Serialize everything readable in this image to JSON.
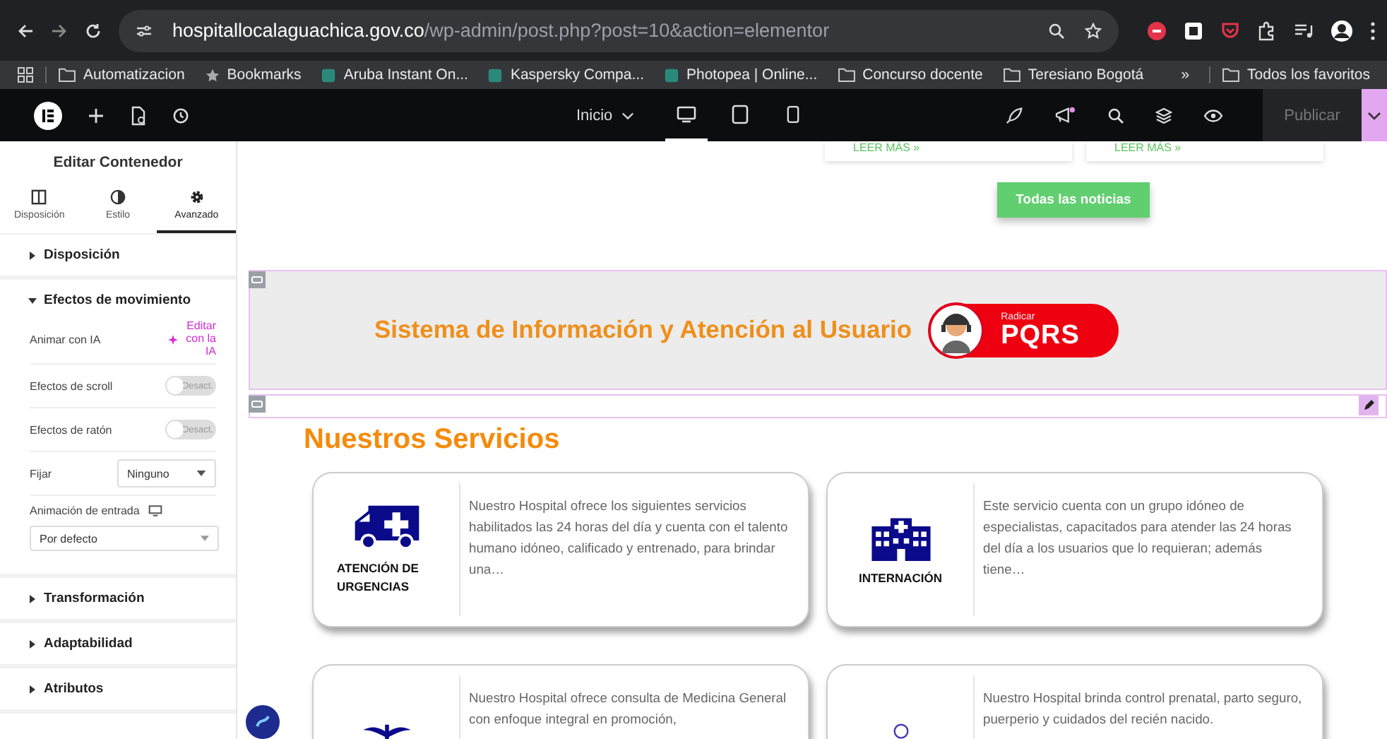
{
  "browser": {
    "host": "hospitallocalaguachica.gov.co",
    "path": "/wp-admin/post.php?post=10&action=elementor",
    "bookmarks": [
      {
        "kind": "folder",
        "label": "Automatizacion"
      },
      {
        "kind": "star",
        "label": "Bookmarks"
      },
      {
        "kind": "site",
        "label": "Aruba Instant On..."
      },
      {
        "kind": "site",
        "label": "Kaspersky Compa..."
      },
      {
        "kind": "site",
        "label": "Photopea | Online..."
      },
      {
        "kind": "folder",
        "label": "Concurso docente"
      },
      {
        "kind": "folder",
        "label": "Teresiano Bogotá"
      }
    ],
    "more": "»",
    "all_bookmarks": "Todos los favoritos"
  },
  "editor_bar": {
    "page_menu": "Inicio",
    "devices": [
      {
        "kind": "desktop",
        "selected": true
      },
      {
        "kind": "tablet",
        "selected": false
      },
      {
        "kind": "mobile",
        "selected": false
      }
    ],
    "publish": "Publicar"
  },
  "panel": {
    "title": "Editar Contenedor",
    "tabs": [
      {
        "kind": "layout",
        "label": "Disposición",
        "selected": false
      },
      {
        "kind": "style",
        "label": "Estilo",
        "selected": false
      },
      {
        "kind": "advanced",
        "label": "Avanzado",
        "selected": true
      }
    ],
    "sections": [
      {
        "title": "Disposición",
        "expanded": false
      },
      {
        "title": "Efectos de movimiento",
        "expanded": true,
        "controls": [
          {
            "kind": "ai",
            "label": "Animar con IA",
            "link": "Editar con la IA"
          },
          {
            "kind": "switch",
            "label": "Efectos de scroll",
            "on": false,
            "state_label": "Desact."
          },
          {
            "kind": "switch",
            "label": "Efectos de ratón",
            "on": false,
            "state_label": "Desact."
          },
          {
            "kind": "select",
            "label": "Fijar",
            "value": "Ninguno"
          },
          {
            "kind": "select_block",
            "label": "Animación de entrada",
            "value": "Por defecto"
          }
        ]
      },
      {
        "title": "Transformación",
        "expanded": false
      },
      {
        "title": "Adaptabilidad",
        "expanded": false
      },
      {
        "title": "Atributos",
        "expanded": false
      }
    ]
  },
  "canvas": {
    "news_links": [
      "LEER MÁS »",
      "LEER MÁS »"
    ],
    "all_news_button": "Todas las noticias",
    "banner": {
      "title": "Sistema de Información y Atención al Usuario",
      "badge_small": "Radicar",
      "badge_big": "PQRS"
    },
    "services": {
      "heading": "Nuestros Servicios",
      "cards": [
        {
          "title": "ATENCIÓN DE URGENCIAS",
          "text": "Nuestro Hospital ofrece los siguientes servicios habilitados las 24 horas del día y cuenta con el talento humano idóneo, calificado y entrenado, para brindar una…"
        },
        {
          "title": "INTERNACIÓN",
          "text": "Este servicio  cuenta con un grupo idóneo de especialistas, capacitados para atender las 24 horas del día a los usuarios que lo requieran; además tiene…"
        },
        {
          "text": "Nuestro Hospital ofrece consulta de Medicina General con enfoque integral en promoción,"
        },
        {
          "text": "Nuestro Hospital brinda control prenatal, parto seguro, puerperio y cuidados del recién nacido."
        }
      ]
    }
  }
}
